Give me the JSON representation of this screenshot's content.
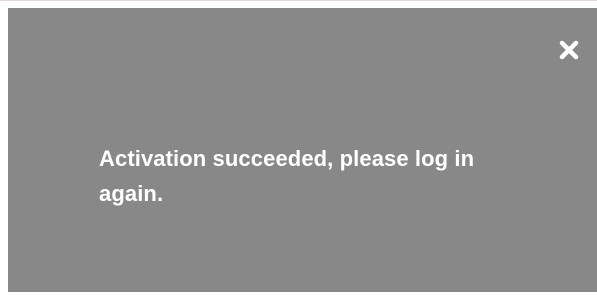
{
  "dialog": {
    "message": "Activation succeeded, please log in again.",
    "close_icon": "close-icon",
    "background_color": "#888888",
    "text_color": "#ffffff"
  }
}
